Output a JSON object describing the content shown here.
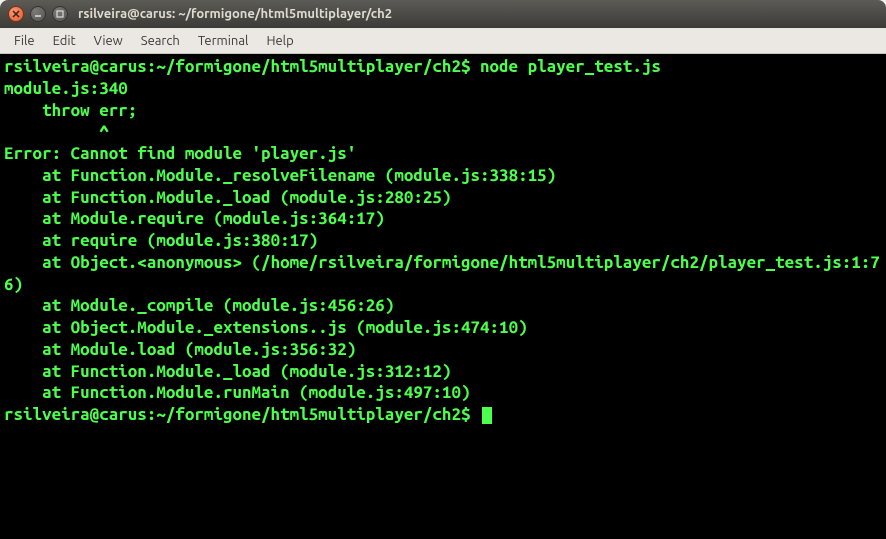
{
  "window": {
    "title": "rsilveira@carus: ~/formigone/html5multiplayer/ch2"
  },
  "menubar": {
    "items": [
      "File",
      "Edit",
      "View",
      "Search",
      "Terminal",
      "Help"
    ]
  },
  "terminal": {
    "prompt1": "rsilveira@carus:~/formigone/html5multiplayer/ch2$ ",
    "command1": "node player_test.js",
    "blank1": "",
    "line_module": "module.js:340",
    "line_throw": "    throw err;",
    "line_caret": "          ^",
    "line_error": "Error: Cannot find module 'player.js'",
    "line_stack1": "    at Function.Module._resolveFilename (module.js:338:15)",
    "line_stack2": "    at Function.Module._load (module.js:280:25)",
    "line_stack3": "    at Module.require (module.js:364:17)",
    "line_stack4": "    at require (module.js:380:17)",
    "line_stack5": "    at Object.<anonymous> (/home/rsilveira/formigone/html5multiplayer/ch2/player_test.js:1:76)",
    "line_stack6": "    at Module._compile (module.js:456:26)",
    "line_stack7": "    at Object.Module._extensions..js (module.js:474:10)",
    "line_stack8": "    at Module.load (module.js:356:32)",
    "line_stack9": "    at Function.Module._load (module.js:312:12)",
    "line_stack10": "    at Function.Module.runMain (module.js:497:10)",
    "prompt2": "rsilveira@carus:~/formigone/html5multiplayer/ch2$ "
  }
}
